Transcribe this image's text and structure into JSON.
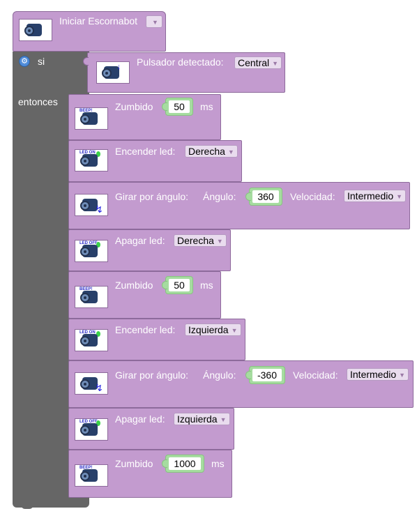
{
  "hat": {
    "label": "Iniciar Escornabot",
    "icon": "escornabot-robot-icon"
  },
  "if_block": {
    "si_label": "si",
    "entonces_label": "entonces",
    "condition": {
      "label": "Pulsador detectado:",
      "value": "Central"
    }
  },
  "statements": [
    {
      "kind": "zumbido",
      "label": "Zumbido",
      "value": "50",
      "unit": "ms",
      "icon_text": "BEEP!"
    },
    {
      "kind": "encender",
      "label": "Encender led:",
      "value": "Derecha",
      "icon_text": "LED ON"
    },
    {
      "kind": "girar",
      "label": "Girar por ángulo:",
      "angle_label": "Ángulo:",
      "angle": "360",
      "speed_label": "Velocidad:",
      "speed": "Intermedio"
    },
    {
      "kind": "apagar",
      "label": "Apagar led:",
      "value": "Derecha",
      "icon_text": "LED OFF"
    },
    {
      "kind": "zumbido",
      "label": "Zumbido",
      "value": "50",
      "unit": "ms",
      "icon_text": "BEEP!"
    },
    {
      "kind": "encender",
      "label": "Encender led:",
      "value": "Izquierda",
      "icon_text": "LED ON"
    },
    {
      "kind": "girar",
      "label": "Girar por ángulo:",
      "angle_label": "Ángulo:",
      "angle": "-360",
      "speed_label": "Velocidad:",
      "speed": "Intermedio"
    },
    {
      "kind": "apagar",
      "label": "Apagar led:",
      "value": "Izquierda",
      "icon_text": "LED OFF"
    },
    {
      "kind": "zumbido",
      "label": "Zumbido",
      "value": "1000",
      "unit": "ms",
      "icon_text": "BEEP!"
    }
  ],
  "colors": {
    "block_fill": "#c39bcf",
    "block_border": "#8d6a9b",
    "c_block_fill": "#666666",
    "number_fill": "#a6dca0"
  }
}
